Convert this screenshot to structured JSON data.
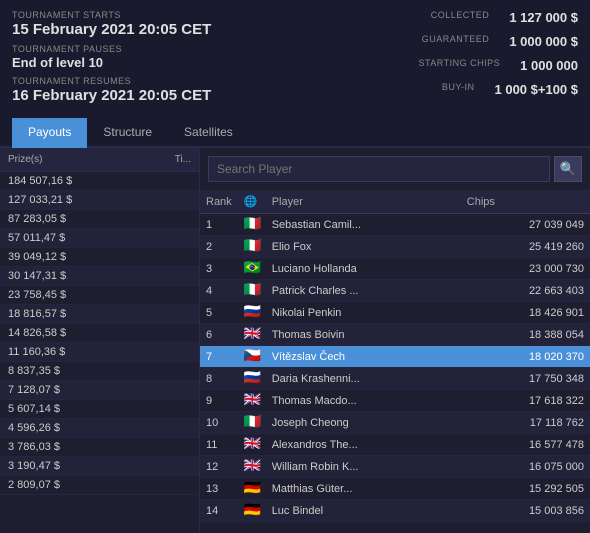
{
  "header": {
    "tournament_starts_label": "TOURNAMENT STARTS",
    "tournament_starts_value": "15 February 2021  20:05 CET",
    "tournament_pauses_label": "TOURNAMENT PAUSES",
    "tournament_pauses_value": "End of level 10",
    "tournament_resumes_label": "TOURNAMENT RESUMES",
    "tournament_resumes_value": "16 February 2021  20:05 CET",
    "collected_label": "COLLECTED",
    "collected_value": "1 127 000 $",
    "guaranteed_label": "GUARANTEED",
    "guaranteed_value": "1 000 000 $",
    "starting_chips_label": "STARTING CHIPS",
    "starting_chips_value": "1 000 000",
    "buy_in_label": "BUY-IN",
    "buy_in_value": "1 000 $+100 $"
  },
  "tabs": [
    {
      "label": "Payouts",
      "active": true
    },
    {
      "label": "Structure",
      "active": false
    },
    {
      "label": "Satellites",
      "active": false
    }
  ],
  "payouts": {
    "col1_header": "Prize(s)",
    "col2_header": "Ti...",
    "rows": [
      {
        "prize": "184 507,16 $"
      },
      {
        "prize": "127 033,21 $"
      },
      {
        "prize": "87 283,05 $"
      },
      {
        "prize": "57 011,47 $"
      },
      {
        "prize": "39 049,12 $"
      },
      {
        "prize": "30 147,31 $"
      },
      {
        "prize": "23 758,45 $"
      },
      {
        "prize": "18 816,57 $"
      },
      {
        "prize": "14 826,58 $"
      },
      {
        "prize": "11 160,36 $"
      },
      {
        "prize": "8 837,35 $"
      },
      {
        "prize": "7 128,07 $"
      },
      {
        "prize": "5 607,14 $"
      },
      {
        "prize": "4 596,26 $"
      },
      {
        "prize": "3 786,03 $"
      },
      {
        "prize": "3 190,47 $"
      },
      {
        "prize": "2 809,07 $"
      }
    ]
  },
  "players": {
    "search_placeholder": "Search Player",
    "search_icon": "🔍",
    "col_rank": "Rank",
    "col_flag": "🌐",
    "col_player": "Player",
    "col_chips": "Chips",
    "rows": [
      {
        "rank": 1,
        "flag": "🇮🇹",
        "player": "Sebastian Camil...",
        "chips": "27 039 049",
        "highlighted": false
      },
      {
        "rank": 2,
        "flag": "🇮🇹",
        "player": "Elio Fox",
        "chips": "25 419 260",
        "highlighted": false
      },
      {
        "rank": 3,
        "flag": "🇧🇷",
        "player": "Luciano Hollanda",
        "chips": "23 000 730",
        "highlighted": false
      },
      {
        "rank": 4,
        "flag": "🇮🇹",
        "player": "Patrick Charles ...",
        "chips": "22 663 403",
        "highlighted": false
      },
      {
        "rank": 5,
        "flag": "🇷🇺",
        "player": "Nikolai Penkin",
        "chips": "18 426 901",
        "highlighted": false
      },
      {
        "rank": 6,
        "flag": "🇬🇧",
        "player": "Thomas Boivin",
        "chips": "18 388 054",
        "highlighted": false
      },
      {
        "rank": 7,
        "flag": "🇨🇿",
        "player": "Vítězslav Čech",
        "chips": "18 020 370",
        "highlighted": true
      },
      {
        "rank": 8,
        "flag": "🇷🇺",
        "player": "Daria Krashenni...",
        "chips": "17 750 348",
        "highlighted": false
      },
      {
        "rank": 9,
        "flag": "🇬🇧",
        "player": "Thomas Macdo...",
        "chips": "17 618 322",
        "highlighted": false
      },
      {
        "rank": 10,
        "flag": "🇮🇹",
        "player": "Joseph Cheong",
        "chips": "17 118 762",
        "highlighted": false
      },
      {
        "rank": 11,
        "flag": "🇬🇧",
        "player": "Alexandros The...",
        "chips": "16 577 478",
        "highlighted": false
      },
      {
        "rank": 12,
        "flag": "🇬🇧",
        "player": "William Robin K...",
        "chips": "16 075 000",
        "highlighted": false
      },
      {
        "rank": 13,
        "flag": "🇩🇪",
        "player": "Matthias Güter...",
        "chips": "15 292 505",
        "highlighted": false
      },
      {
        "rank": 14,
        "flag": "🇩🇪",
        "player": "Luc Bindel",
        "chips": "15 003 856",
        "highlighted": false
      }
    ]
  }
}
